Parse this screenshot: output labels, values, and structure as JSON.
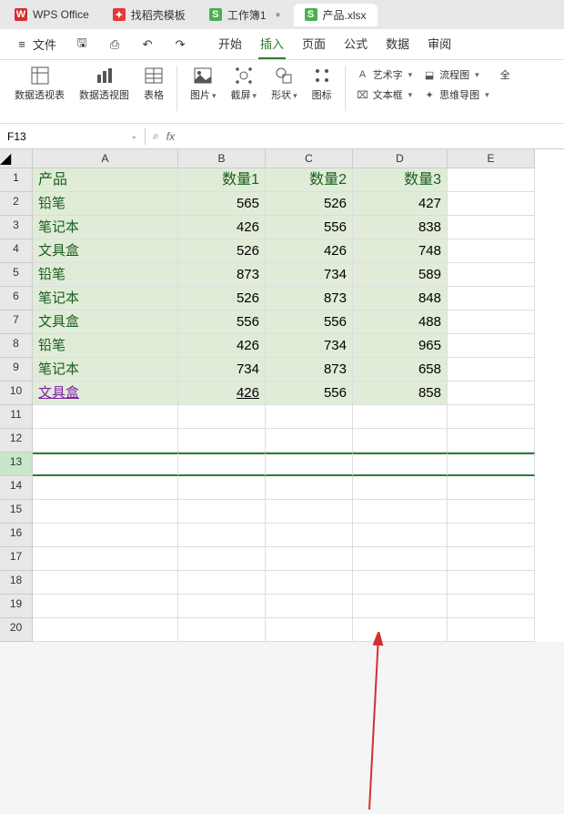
{
  "tabs": [
    {
      "icon": "W",
      "cls": "ic-wps",
      "label": "WPS Office"
    },
    {
      "icon": "✦",
      "cls": "ic-dao",
      "label": "找稻壳模板"
    },
    {
      "icon": "S",
      "cls": "ic-s",
      "label": "工作簿1"
    },
    {
      "icon": "S",
      "cls": "ic-s",
      "label": "产品.xlsx",
      "active": true
    }
  ],
  "menubar": {
    "file": "文件",
    "menu_tabs": [
      "开始",
      "插入",
      "页面",
      "公式",
      "数据",
      "审阅"
    ],
    "active_menu": "插入"
  },
  "ribbon": {
    "g1": "数据透视表",
    "g2": "数据透视图",
    "g3": "表格",
    "g4": "图片",
    "g5": "截屏",
    "g6": "形状",
    "g7": "图标",
    "r1": "艺术字",
    "r2": "文本框",
    "r3": "流程图",
    "r4": "思维导图",
    "r5": "全"
  },
  "fbar": {
    "name": "F13",
    "fx": "fx"
  },
  "cols": [
    "A",
    "B",
    "C",
    "D",
    "E"
  ],
  "headers": [
    "产品",
    "数量1",
    "数量2",
    "数量3"
  ],
  "rows": [
    {
      "a": "铅笔",
      "b": 565,
      "c": 526,
      "d": 427
    },
    {
      "a": "笔记本",
      "b": 426,
      "c": 556,
      "d": 838
    },
    {
      "a": "文具盒",
      "b": 526,
      "c": 426,
      "d": 748
    },
    {
      "a": "铅笔",
      "b": 873,
      "c": 734,
      "d": 589
    },
    {
      "a": "笔记本",
      "b": 526,
      "c": 873,
      "d": 848
    },
    {
      "a": "文具盒",
      "b": 556,
      "c": 556,
      "d": 488
    },
    {
      "a": "铅笔",
      "b": 426,
      "c": 734,
      "d": 965
    },
    {
      "a": "笔记本",
      "b": 734,
      "c": 873,
      "d": 658
    },
    {
      "a": "文具盒",
      "b": 426,
      "c": 556,
      "d": 858,
      "link": true
    }
  ],
  "selected_row": 13,
  "total_rows": 20
}
